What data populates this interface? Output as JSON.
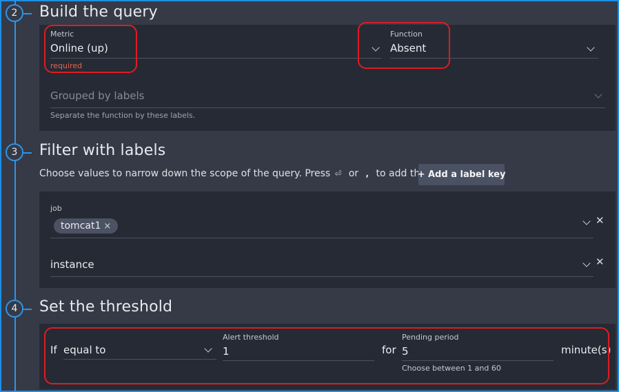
{
  "steps": [
    {
      "number": "2",
      "title": "Build the query"
    },
    {
      "number": "3",
      "title": "Filter with labels"
    },
    {
      "number": "4",
      "title": "Set the threshold"
    }
  ],
  "query": {
    "metric": {
      "label": "Metric",
      "value": "Online (up)",
      "error": "required"
    },
    "function": {
      "label": "Function",
      "value": "Absent"
    },
    "grouped_by": {
      "placeholder": "Grouped by labels",
      "help": "Separate the function by these labels."
    }
  },
  "filter": {
    "description_pre": "Choose values to narrow down the scope of the query. Press",
    "enter_symbol": "⏎",
    "or_word": "or",
    "comma_key": ",",
    "description_post": "to add them.",
    "add_button": "+ Add a label key",
    "labels": [
      {
        "key": "job",
        "chips": [
          "tomcat1"
        ]
      },
      {
        "key": "instance",
        "chips": []
      }
    ]
  },
  "threshold": {
    "if_label": "If",
    "operator": "equal to",
    "alert_label": "Alert threshold",
    "alert_value": "1",
    "for_label": "for",
    "pending_label": "Pending period",
    "pending_value": "5",
    "pending_help": "Choose between 1 and 60",
    "unit": "minute(s)"
  },
  "colors": {
    "accent": "#2f93e6",
    "highlight": "#e11b22",
    "error": "#e8654a"
  }
}
